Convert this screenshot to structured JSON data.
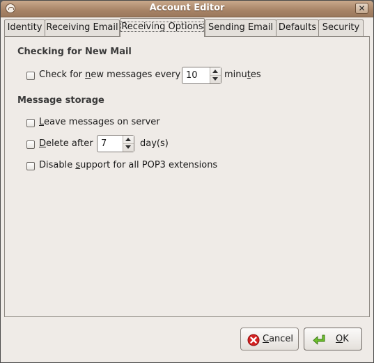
{
  "window": {
    "title": "Account Editor",
    "close_glyph": "✕"
  },
  "tabs": [
    {
      "label": "Identity"
    },
    {
      "label": "Receiving Email"
    },
    {
      "label": "Receiving Options"
    },
    {
      "label": "Sending Email"
    },
    {
      "label": "Defaults"
    },
    {
      "label": "Security"
    }
  ],
  "active_tab": "Receiving Options",
  "checking": {
    "title": "Checking for New Mail",
    "check_new": {
      "checked": false,
      "label_a": "Check for ",
      "label_u": "n",
      "label_b": "ew messages every",
      "interval": "10",
      "unit_a": "minu",
      "unit_u": "t",
      "unit_b": "es"
    }
  },
  "storage": {
    "title": "Message storage",
    "leave": {
      "checked": false,
      "label_u": "L",
      "label_b": "eave messages on server"
    },
    "delete": {
      "checked": false,
      "label_u": "D",
      "label_b": "elete after",
      "days": "7",
      "unit": "day(s)"
    },
    "disable": {
      "checked": false,
      "label_a": "Disable ",
      "label_u": "s",
      "label_b": "upport for all POP3 extensions"
    }
  },
  "buttons": {
    "cancel": {
      "label_u": "C",
      "label_b": "ancel"
    },
    "ok": {
      "label_u": "O",
      "label_b": "K"
    }
  },
  "icons": {
    "cancel": "cancel-icon",
    "ok": "ok-arrow-icon",
    "window": "mail-app-icon"
  },
  "colors": {
    "titlebar": "#a78366",
    "background": "#efebe7",
    "cancel_red": "#d42020",
    "ok_green": "#5ea626"
  }
}
